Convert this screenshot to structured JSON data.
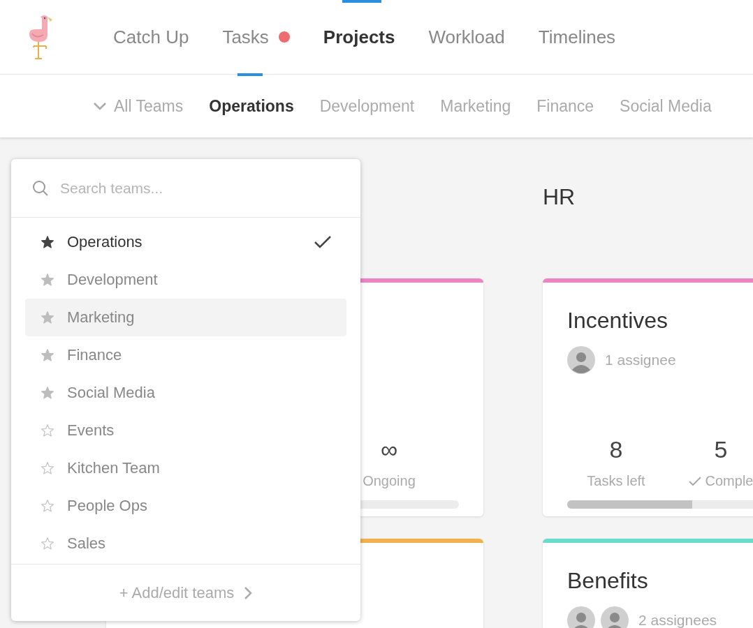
{
  "nav": [
    {
      "label": "Catch Up",
      "selected": false,
      "notification": false,
      "underline": false
    },
    {
      "label": "Tasks",
      "selected": false,
      "notification": true,
      "underline": true
    },
    {
      "label": "Projects",
      "selected": true,
      "notification": false,
      "underline": false
    },
    {
      "label": "Workload",
      "selected": false,
      "notification": false,
      "underline": false
    },
    {
      "label": "Timelines",
      "selected": false,
      "notification": false,
      "underline": false
    }
  ],
  "team_filter": {
    "label": "All Teams"
  },
  "team_tabs": [
    {
      "label": "Operations",
      "selected": true
    },
    {
      "label": "Development",
      "selected": false
    },
    {
      "label": "Marketing",
      "selected": false
    },
    {
      "label": "Finance",
      "selected": false
    },
    {
      "label": "Social Media",
      "selected": false
    }
  ],
  "columns": [
    {
      "cards": [
        {
          "color": "#ee82c2",
          "stats": [
            {
              "kind": "ongoing",
              "value": "∞",
              "label": "Ongoing"
            }
          ],
          "progress": {
            "level": 0
          }
        },
        {
          "color": "#f2b04f"
        }
      ]
    },
    {
      "title": "HR",
      "cards": [
        {
          "color": "#ee82c2",
          "title": "Incentives",
          "avatars": [
            {
              "kind": "person"
            }
          ],
          "assignees": "1 assignee",
          "stats": [
            {
              "kind": "left",
              "value": "8",
              "label": "Tasks left"
            },
            {
              "kind": "completed",
              "value": "5",
              "label": "Comple"
            }
          ],
          "progress": {
            "level": 0.38
          }
        },
        {
          "color": "#6adccb",
          "title": "Benefits",
          "avatars": [
            {
              "kind": "person"
            },
            {
              "kind": "person"
            }
          ],
          "assignees": "2 assignees"
        }
      ]
    }
  ],
  "team_dropdown": {
    "search": {
      "placeholder": "Search teams..."
    },
    "items": [
      {
        "label": "Operations",
        "starred": true,
        "selected": true,
        "highlighted": false
      },
      {
        "label": "Development",
        "starred": true,
        "selected": false,
        "highlighted": false
      },
      {
        "label": "Marketing",
        "starred": true,
        "selected": false,
        "highlighted": true
      },
      {
        "label": "Finance",
        "starred": true,
        "selected": false,
        "highlighted": false
      },
      {
        "label": "Social Media",
        "starred": true,
        "selected": false,
        "highlighted": false
      },
      {
        "label": "Events",
        "starred": false,
        "selected": false,
        "highlighted": false
      },
      {
        "label": "Kitchen Team",
        "starred": false,
        "selected": false,
        "highlighted": false
      },
      {
        "label": "People Ops",
        "starred": false,
        "selected": false,
        "highlighted": false
      },
      {
        "label": "Sales",
        "starred": false,
        "selected": false,
        "highlighted": false
      }
    ],
    "footer": "+ Add/edit teams"
  }
}
